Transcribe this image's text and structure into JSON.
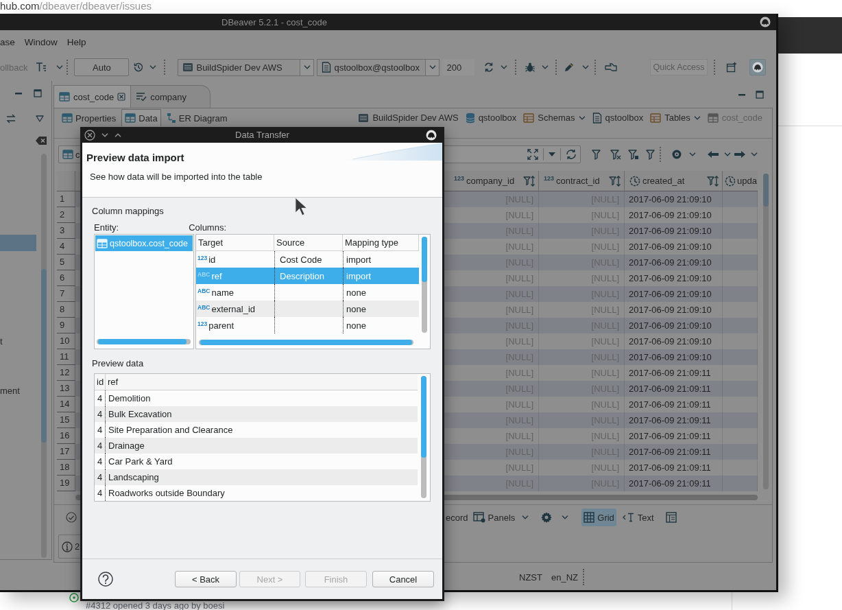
{
  "browser": {
    "address_host": "hub.com",
    "address_path": "/dbeaver/dbeaver/issues",
    "issue_meta": "#4312 opened 3 days ago by boesi"
  },
  "window": {
    "title": "DBeaver 5.2.1 - cost_code"
  },
  "menu": [
    "ase",
    "Window",
    "Help"
  ],
  "toolbar": {
    "rollback": {
      "label": "ollback",
      "disabled": true
    },
    "commit_mode": "Auto",
    "datasource": "BuildSpider Dev AWS",
    "schema": "qstoolbox@qstoolbox",
    "fetch_size": "200",
    "quick_access": {
      "placeholder": "Quick Access"
    }
  },
  "navigator": {
    "items": [
      {
        "selected": true
      },
      {
        "label": "t",
        "selected": false
      },
      {
        "label": "ment",
        "selected": false
      }
    ]
  },
  "editor_tabs": [
    {
      "label": "cost_code",
      "kind": "table",
      "selected": true,
      "closable": true
    },
    {
      "label": "company",
      "kind": "script",
      "selected": false,
      "closable": false
    }
  ],
  "view_tabs": [
    {
      "label": "Properties",
      "kind": "properties",
      "selected": false
    },
    {
      "label": "Data",
      "kind": "data",
      "selected": true
    },
    {
      "label": "ER Diagram",
      "kind": "diagram",
      "selected": false
    }
  ],
  "breadcrumb": [
    {
      "label": "BuildSpider Dev AWS",
      "kind": "connection",
      "dropdown": false,
      "disabled": false
    },
    {
      "label": "qstoolbox",
      "kind": "database",
      "dropdown": false,
      "disabled": false
    },
    {
      "label": "Schemas",
      "kind": "folder",
      "dropdown": true,
      "disabled": false
    },
    {
      "label": "qstoolbox",
      "kind": "schema",
      "dropdown": false,
      "disabled": false
    },
    {
      "label": "Tables",
      "kind": "folder",
      "dropdown": true,
      "disabled": false
    },
    {
      "label": "cost_code",
      "kind": "table",
      "dropdown": false,
      "disabled": true
    }
  ],
  "filter": {
    "value": "c"
  },
  "grid": {
    "columns": [
      {
        "type_mark": "123",
        "label": "company_id",
        "kind": "number",
        "truncated": false
      },
      {
        "type_mark": "123",
        "label": "contract_id",
        "kind": "number",
        "truncated": false
      },
      {
        "label": "created_at",
        "kind": "datetime",
        "truncated": false
      },
      {
        "label": "upda",
        "kind": "datetime",
        "truncated": true
      }
    ],
    "rows": [
      {
        "number": "1",
        "cells": [
          "[NULL]",
          "[NULL]",
          "2017-06-09 21:09:10"
        ]
      },
      {
        "number": "2",
        "cells": [
          "[NULL]",
          "[NULL]",
          "2017-06-09 21:09:10"
        ]
      },
      {
        "number": "3",
        "cells": [
          "[NULL]",
          "[NULL]",
          "2017-06-09 21:09:10"
        ]
      },
      {
        "number": "4",
        "cells": [
          "[NULL]",
          "[NULL]",
          "2017-06-09 21:09:10"
        ]
      },
      {
        "number": "5",
        "cells": [
          "[NULL]",
          "[NULL]",
          "2017-06-09 21:09:10"
        ]
      },
      {
        "number": "6",
        "cells": [
          "[NULL]",
          "[NULL]",
          "2017-06-09 21:09:10"
        ]
      },
      {
        "number": "7",
        "cells": [
          "[NULL]",
          "[NULL]",
          "2017-06-09 21:09:10"
        ]
      },
      {
        "number": "8",
        "cells": [
          "[NULL]",
          "[NULL]",
          "2017-06-09 21:09:10"
        ]
      },
      {
        "number": "9",
        "cells": [
          "[NULL]",
          "[NULL]",
          "2017-06-09 21:09:10"
        ]
      },
      {
        "number": "10",
        "cells": [
          "[NULL]",
          "[NULL]",
          "2017-06-09 21:09:10"
        ]
      },
      {
        "number": "11",
        "cells": [
          "[NULL]",
          "[NULL]",
          "2017-06-09 21:09:10"
        ]
      },
      {
        "number": "12",
        "cells": [
          "[NULL]",
          "[NULL]",
          "2017-06-09 21:09:11"
        ]
      },
      {
        "number": "13",
        "cells": [
          "[NULL]",
          "[NULL]",
          "2017-06-09 21:09:11"
        ]
      },
      {
        "number": "14",
        "cells": [
          "[NULL]",
          "[NULL]",
          "2017-06-09 21:09:11"
        ]
      },
      {
        "number": "15",
        "cells": [
          "[NULL]",
          "[NULL]",
          "2017-06-09 21:09:11"
        ]
      },
      {
        "number": "16",
        "cells": [
          "[NULL]",
          "[NULL]",
          "2017-06-09 21:09:11"
        ]
      },
      {
        "number": "17",
        "cells": [
          "[NULL]",
          "[NULL]",
          "2017-06-09 21:09:11"
        ]
      },
      {
        "number": "18",
        "cells": [
          "[NULL]",
          "[NULL]",
          "2017-06-09 21:09:11"
        ]
      },
      {
        "number": "19",
        "cells": [
          "[NULL]",
          "[NULL]",
          "2017-06-09 21:09:11"
        ]
      }
    ]
  },
  "results_toolbar": {
    "record": "ecord",
    "panels": "Panels",
    "views": [
      {
        "label": "Grid",
        "kind": "grid",
        "selected": true
      },
      {
        "label": "Text",
        "kind": "text",
        "selected": false
      }
    ]
  },
  "results_info": "2",
  "status_bar": [
    "NZST",
    "en_NZ"
  ],
  "dialog": {
    "title": "Data Transfer",
    "heading": "Preview data import",
    "description": "See how data will be imported into the table",
    "mappings_label": "Column mappings",
    "entity_label": "Entity:",
    "entities": [
      {
        "label": "qstoolbox.cost_code",
        "selected": true
      }
    ],
    "columns_label": "Columns:",
    "mapping_headers": [
      "Target",
      "Source",
      "Mapping type"
    ],
    "mappings": [
      {
        "type_mark": "123",
        "target": "id",
        "source": "Cost Code",
        "mapping": "import",
        "selected": false
      },
      {
        "type_mark": "ABC",
        "target": "ref",
        "source": "Description",
        "mapping": "import",
        "selected": true
      },
      {
        "type_mark": "ABC",
        "target": "name",
        "mapping": "none",
        "selected": false
      },
      {
        "type_mark": "ABC",
        "target": "external_id",
        "mapping": "none",
        "selected": false
      },
      {
        "type_mark": "123",
        "target": "parent",
        "mapping": "none",
        "selected": false
      }
    ],
    "preview_label": "Preview data",
    "preview_headers": [
      "id",
      "ref"
    ],
    "preview_rows": [
      [
        "4",
        "Demolition"
      ],
      [
        "4",
        "Bulk Excavation"
      ],
      [
        "4",
        "Site Preparation and Clearance"
      ],
      [
        "4",
        "Drainage"
      ],
      [
        "4",
        "Car Park & Yard"
      ],
      [
        "4",
        "Landscaping"
      ],
      [
        "4",
        "Roadworks outside Boundary"
      ]
    ],
    "buttons": [
      {
        "label": "< Back",
        "disabled": false
      },
      {
        "label": "Next >",
        "disabled": true
      },
      {
        "label": "Finish",
        "disabled": true
      },
      {
        "label": "Cancel",
        "disabled": false
      }
    ]
  }
}
